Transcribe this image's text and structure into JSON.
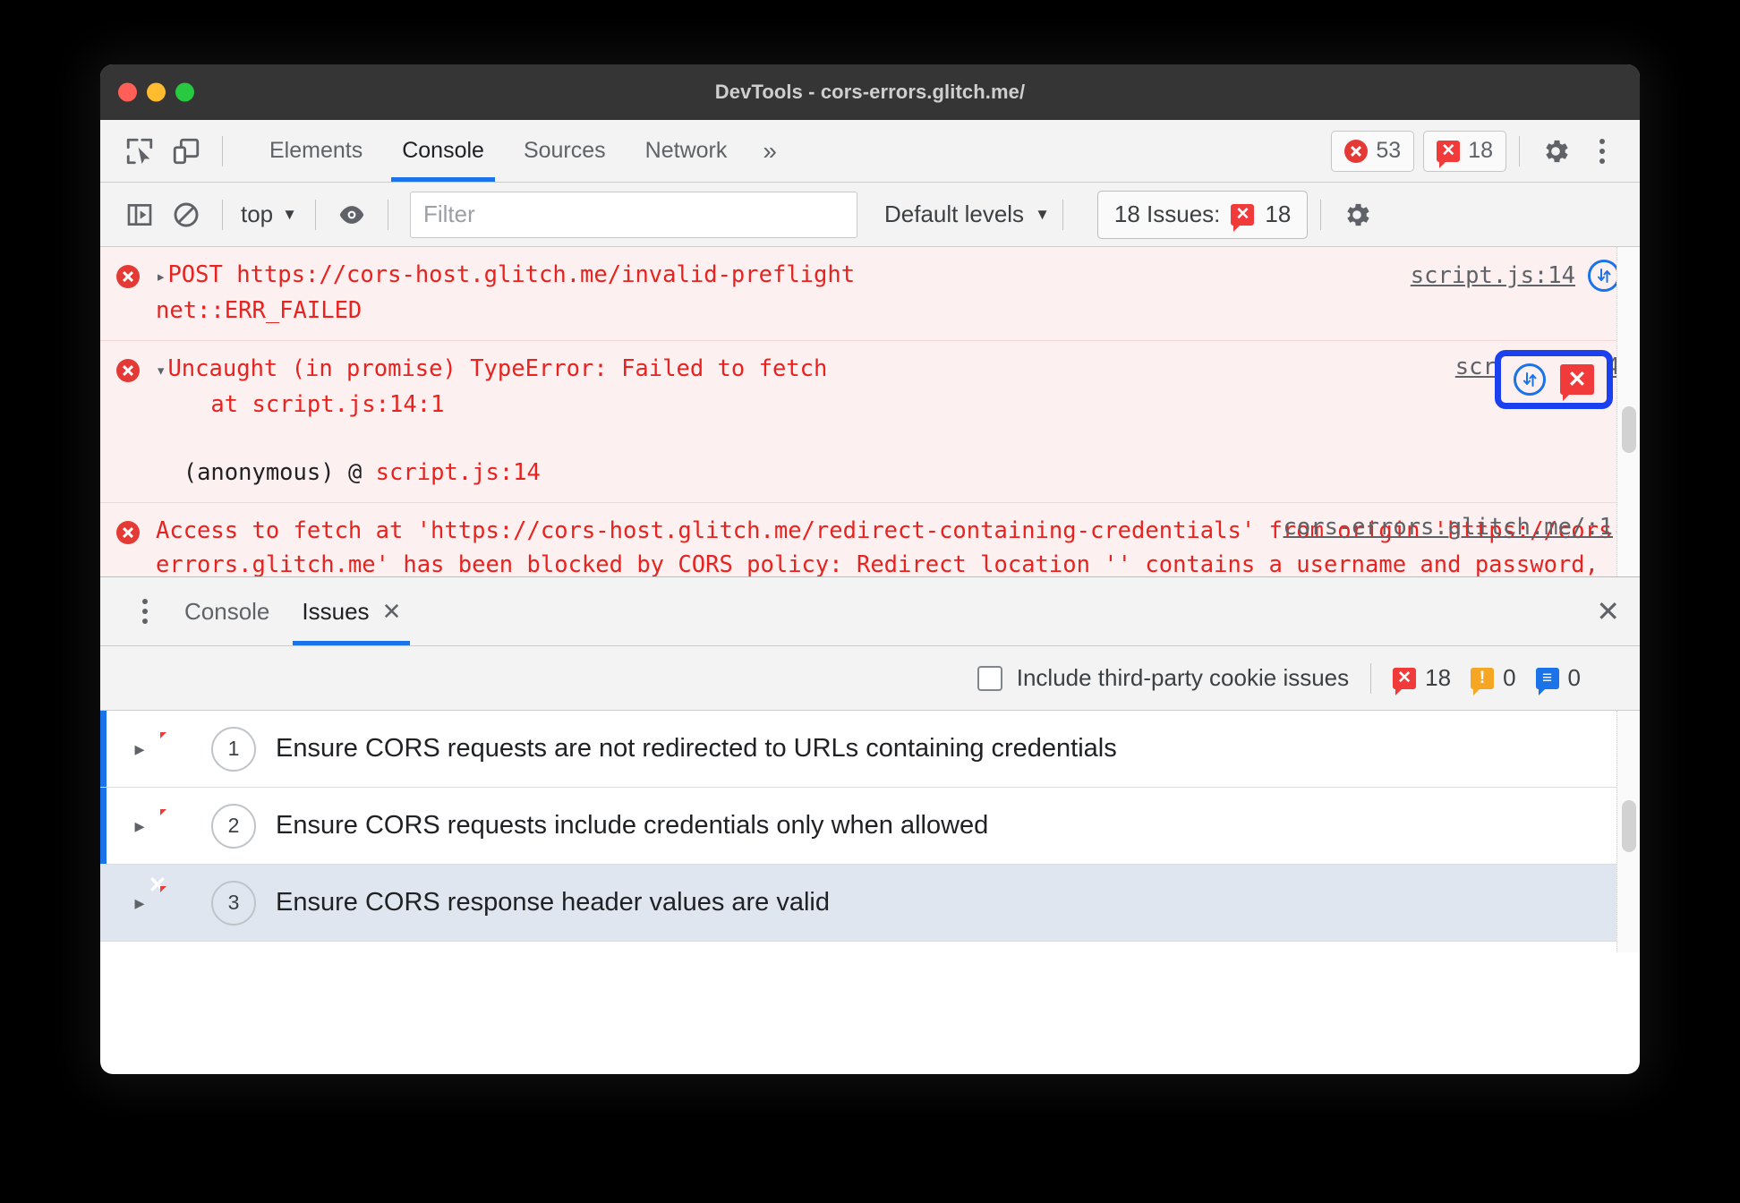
{
  "window": {
    "title": "DevTools - cors-errors.glitch.me/"
  },
  "main_tabs": {
    "inspect_icon": "inspect-cursor-icon",
    "device_icon": "device-toolbar-icon",
    "items": [
      {
        "label": "Elements",
        "active": false
      },
      {
        "label": "Console",
        "active": true
      },
      {
        "label": "Sources",
        "active": false
      },
      {
        "label": "Network",
        "active": false
      }
    ],
    "more": "»",
    "error_count": "53",
    "issue_count": "18",
    "settings_icon": "gear-icon",
    "menu_icon": "kebab-menu-icon"
  },
  "console_toolbar": {
    "sidebar_icon": "show-console-sidebar-icon",
    "clear_icon": "clear-console-icon",
    "context": "top",
    "context_caret": "▼",
    "eye_icon": "live-expression-eye-icon",
    "filter_placeholder": "Filter",
    "filter_value": "",
    "levels": "Default levels",
    "levels_caret": "▼",
    "issues_label": "18 Issues:",
    "issues_value": "18",
    "settings_icon": "console-settings-gear-icon"
  },
  "console_messages": [
    {
      "id": "msg-post-invalid-preflight",
      "expand": "▸",
      "method": "POST",
      "url": "https://cors-host.glitch.me/invalid-preflight",
      "detail": "net::ERR_FAILED",
      "source": "script.js:14",
      "has_network_icon": true,
      "has_issue_icon": false,
      "highlighted": false
    },
    {
      "id": "msg-uncaught-typeerror",
      "expand": "▾",
      "text": "Uncaught (in promise) TypeError: Failed to fetch",
      "stack_at": "at ",
      "stack_link": "script.js:14:1",
      "anon_prefix": "(anonymous) @ ",
      "anon_link": "script.js:14",
      "source": "script.js:14",
      "has_network_icon": true,
      "has_issue_icon": true,
      "highlighted": true
    },
    {
      "id": "msg-cors-blocked",
      "part1": "Access to fetch at '",
      "url1": "https://cors-host.glitch.me/redirect-containing-credentials",
      "part2": "' from origin '",
      "url2": "https://cors-errors.glitch.me",
      "part3": "' has been blocked by CORS policy: Redirect location '' contains a username and password, which is disallowed for cross-origin requests.",
      "source": "cors-errors.glitch.me/:1",
      "has_network_icon": false,
      "has_issue_icon": false,
      "highlighted": false
    }
  ],
  "drawer": {
    "menu_icon": "drawer-kebab-menu-icon",
    "tabs": [
      {
        "label": "Console",
        "active": false,
        "closable": false
      },
      {
        "label": "Issues",
        "active": true,
        "closable": true
      }
    ],
    "close_glyph": "✕",
    "drawer_close_glyph": "✕"
  },
  "issues_filter": {
    "checkbox_label": "Include third-party cookie issues",
    "checked": false,
    "error_count": "18",
    "warning_count": "0",
    "info_count": "0"
  },
  "issues_list": [
    {
      "expand": "▸",
      "severity": "error",
      "count": "1",
      "title": "Ensure CORS requests are not redirected to URLs containing credentials",
      "selected": false
    },
    {
      "expand": "▸",
      "severity": "error",
      "count": "2",
      "title": "Ensure CORS requests include credentials only when allowed",
      "selected": false
    },
    {
      "expand": "▸",
      "severity": "error",
      "count": "3",
      "title": "Ensure CORS response header values are valid",
      "selected": true
    }
  ],
  "colors": {
    "accent": "#1a73e8",
    "error_red": "#e8231f",
    "issue_red": "#f13b3b",
    "highlight_blue": "#1a40f0",
    "selected_row": "#dfe6f0",
    "error_bg": "#fdf0f0"
  }
}
